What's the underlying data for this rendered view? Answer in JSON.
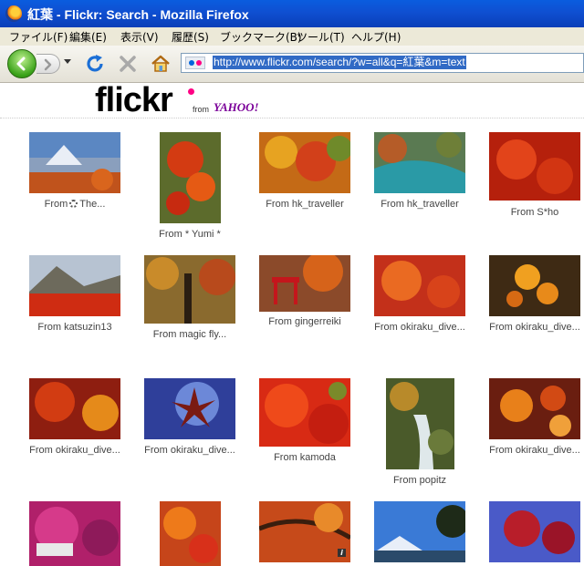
{
  "window": {
    "title": "紅葉 - Flickr: Search - Mozilla Firefox"
  },
  "menu": [
    "ファイル(F)",
    "編集(E)",
    "表示(V)",
    "履歴(S)",
    "ブックマーク(B)",
    "ツール(T)",
    "ヘルプ(H)"
  ],
  "navbar": {
    "url": "http://www.flickr.com/search/?w=all&q=紅葉&m=text"
  },
  "logo": {
    "flickr": "flickr",
    "from": "from",
    "yahoo": "YAHOO!"
  },
  "photos": [
    {
      "caption": "From",
      "caption2": "The...",
      "gear": true
    },
    {
      "caption": "From * Yumi *"
    },
    {
      "caption": "From hk_traveller"
    },
    {
      "caption": "From hk_traveller"
    },
    {
      "caption": "From S*ho"
    },
    {
      "caption": "From katsuzin13"
    },
    {
      "caption": "From magic fly..."
    },
    {
      "caption": "From gingerreiki"
    },
    {
      "caption": "From okiraku_dive..."
    },
    {
      "caption": "From okiraku_dive..."
    },
    {
      "caption": "From okiraku_dive..."
    },
    {
      "caption": "From okiraku_dive..."
    },
    {
      "caption": "From kamoda"
    },
    {
      "caption": "From popitz"
    },
    {
      "caption": "From okiraku_dive..."
    },
    {},
    {},
    {},
    {},
    {}
  ],
  "colors": {
    "titlebar": "#0f4fd1",
    "flickr_blue": "#0063dc",
    "flickr_pink": "#ff0084",
    "url_selection": "#316ac5"
  }
}
